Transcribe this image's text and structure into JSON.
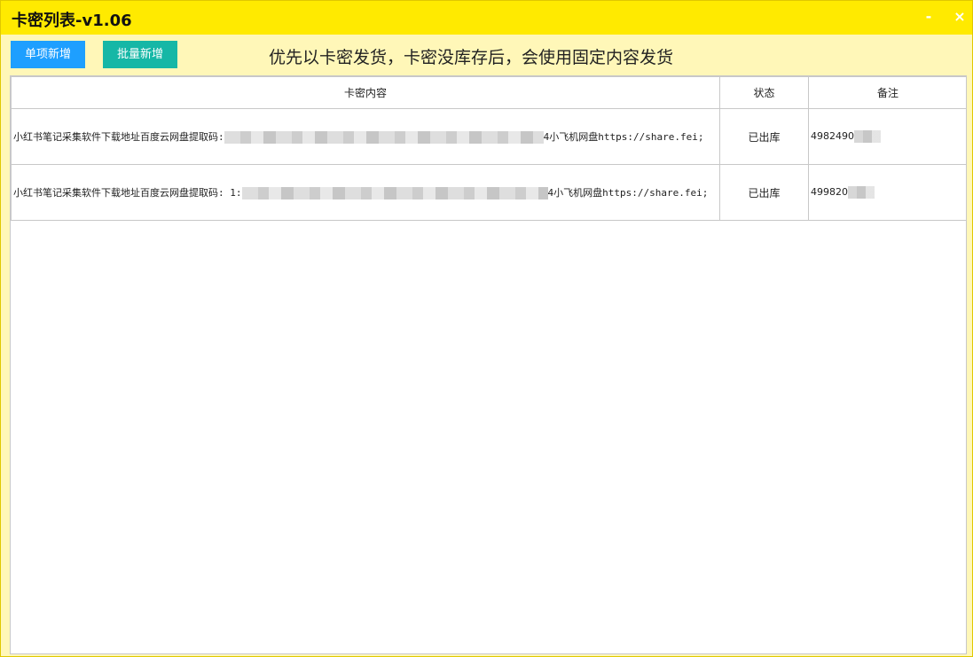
{
  "window": {
    "title": "卡密列表-v1.06",
    "minimize_glyph": "-",
    "close_glyph": "×"
  },
  "toolbar": {
    "single_add_label": "单项新增",
    "batch_add_label": "批量新增"
  },
  "notice": "优先以卡密发货，卡密没库存后，会使用固定内容发货",
  "table": {
    "headers": {
      "content": "卡密内容",
      "status": "状态",
      "note": "备注"
    },
    "rows": [
      {
        "content_prefix": "小红书笔记采集软件下载地址百度云网盘提取码:",
        "content_suffix": "4小飞机网盘https://share.fei;",
        "status": "已出库",
        "note": "4982490"
      },
      {
        "content_prefix": "小红书笔记采集软件下载地址百度云网盘提取码: 1:",
        "content_suffix": "4小飞机网盘https://share.fei;",
        "status": "已出库",
        "note": "499820"
      }
    ]
  },
  "colors": {
    "titlebar": "#ffea00",
    "window_bg": "#fff7b8",
    "single_btn": "#1e9fff",
    "batch_btn": "#16b7a6"
  }
}
